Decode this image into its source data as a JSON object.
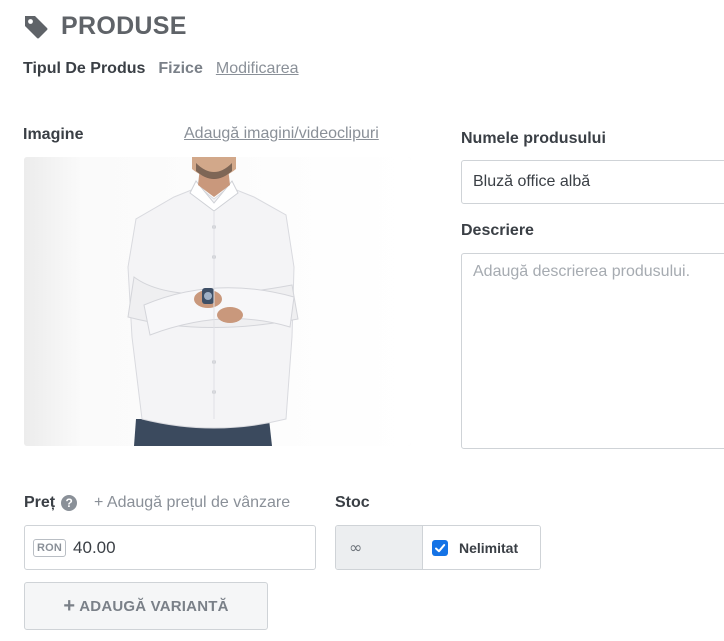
{
  "header": {
    "title": "PRODUSE",
    "icon": "tag-icon"
  },
  "product_type": {
    "label": "Tipul De Produs",
    "value": "Fizice",
    "change_link": "Modificarea"
  },
  "image_section": {
    "label": "Imagine",
    "add_link": "Adaugă imagini/videoclipuri"
  },
  "name_field": {
    "label": "Numele produsului",
    "value": "Bluză office albă"
  },
  "description_field": {
    "label": "Descriere",
    "placeholder": "Adaugă descrierea produsului."
  },
  "price": {
    "label": "Preț",
    "help_icon": "question-circle-icon",
    "add_sale_price_link": "+ Adaugă prețul de vânzare",
    "currency": "RON",
    "value": "40.00"
  },
  "stock": {
    "label": "Stoc",
    "value": "∞",
    "unlimited_label": "Nelimitat",
    "unlimited_checked": true
  },
  "add_variant_button": {
    "plus": "+",
    "label": "ADAUGĂ VARIANTĂ"
  },
  "colors": {
    "accent": "#1473e6",
    "text": "#3a3f45",
    "muted": "#8a9098"
  }
}
